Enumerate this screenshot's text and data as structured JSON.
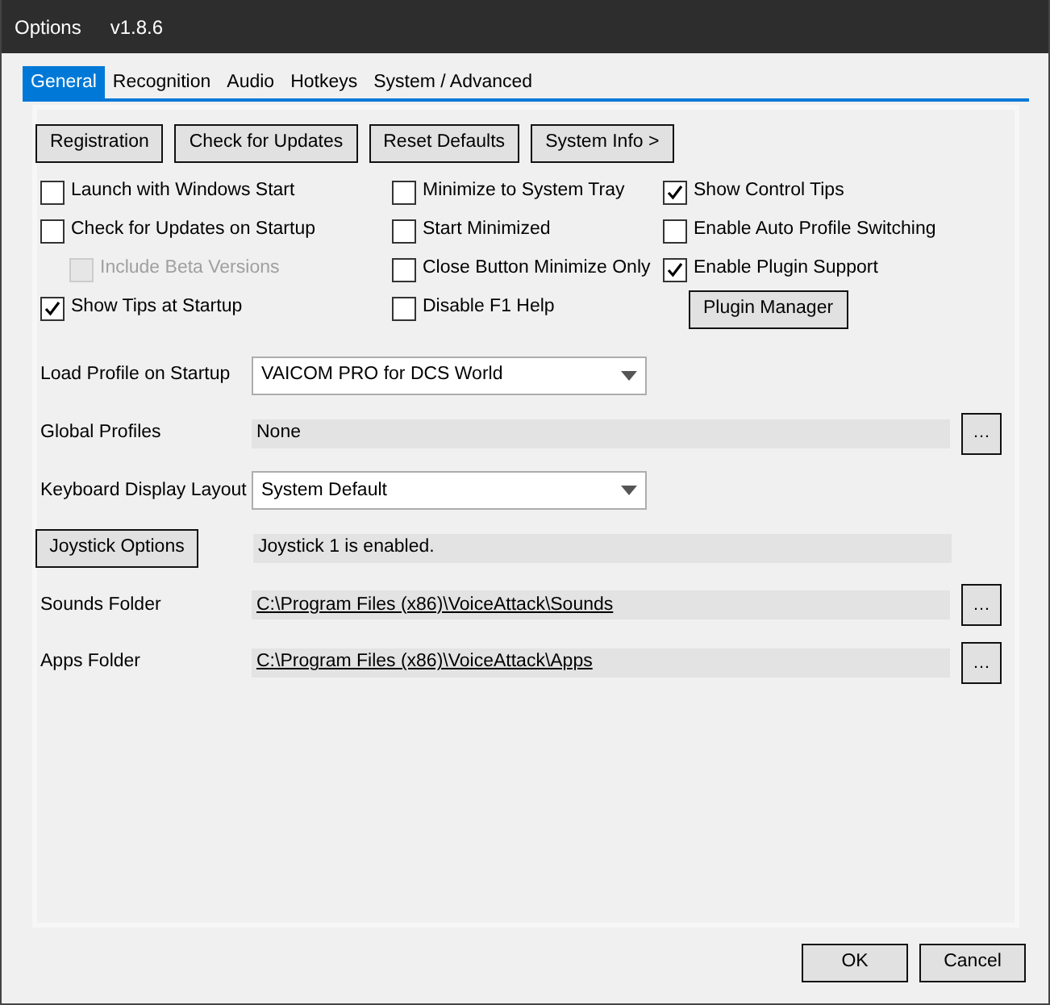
{
  "window": {
    "title": "Options",
    "version": "v1.8.6"
  },
  "tabs": [
    {
      "label": "General",
      "selected": true
    },
    {
      "label": "Recognition",
      "selected": false
    },
    {
      "label": "Audio",
      "selected": false
    },
    {
      "label": "Hotkeys",
      "selected": false
    },
    {
      "label": "System / Advanced",
      "selected": false
    }
  ],
  "top_buttons": [
    "Registration",
    "Check for Updates",
    "Reset Defaults",
    "System Info >"
  ],
  "option_columns": [
    [
      {
        "kind": "checkbox",
        "label": "Launch with Windows Start",
        "checked": false,
        "disabled": false
      },
      {
        "kind": "checkbox",
        "label": "Check for Updates on Startup",
        "checked": false,
        "disabled": false,
        "children": [
          {
            "kind": "checkbox",
            "label": "Include Beta Versions",
            "checked": false,
            "disabled": true
          }
        ]
      },
      {
        "kind": "checkbox",
        "label": "Show Tips at Startup",
        "checked": true,
        "disabled": false
      }
    ],
    [
      {
        "kind": "checkbox",
        "label": "Minimize to System Tray",
        "checked": false,
        "disabled": false
      },
      {
        "kind": "checkbox",
        "label": "Start Minimized",
        "checked": false,
        "disabled": false
      },
      {
        "kind": "checkbox",
        "label": "Close Button Minimize Only",
        "checked": false,
        "disabled": false
      },
      {
        "kind": "checkbox",
        "label": "Disable F1 Help",
        "checked": false,
        "disabled": false
      }
    ],
    [
      {
        "kind": "checkbox",
        "label": "Show Control Tips",
        "checked": true,
        "disabled": false
      },
      {
        "kind": "checkbox",
        "label": "Enable Auto Profile Switching",
        "checked": false,
        "disabled": false
      },
      {
        "kind": "checkbox",
        "label": "Enable Plugin Support",
        "checked": true,
        "disabled": false
      },
      {
        "kind": "button",
        "label": "Plugin Manager"
      }
    ]
  ],
  "settings": [
    {
      "kind": "combo",
      "label": "Load Profile on Startup",
      "value": "VAICOM PRO for DCS World"
    },
    {
      "kind": "readonly",
      "label": "Global Profiles",
      "value": "None",
      "browse": "…"
    },
    {
      "kind": "combo",
      "label": "Keyboard Display Layout",
      "value": "System Default"
    },
    {
      "kind": "status",
      "button": "Joystick Options",
      "value": "Joystick 1 is enabled."
    },
    {
      "kind": "path",
      "label": "Sounds Folder",
      "value": "C:\\Program Files (x86)\\VoiceAttack\\Sounds",
      "browse": "…"
    },
    {
      "kind": "path",
      "label": "Apps Folder",
      "value": "C:\\Program Files (x86)\\VoiceAttack\\Apps",
      "browse": "…"
    }
  ],
  "footer_buttons": [
    "OK",
    "Cancel"
  ]
}
